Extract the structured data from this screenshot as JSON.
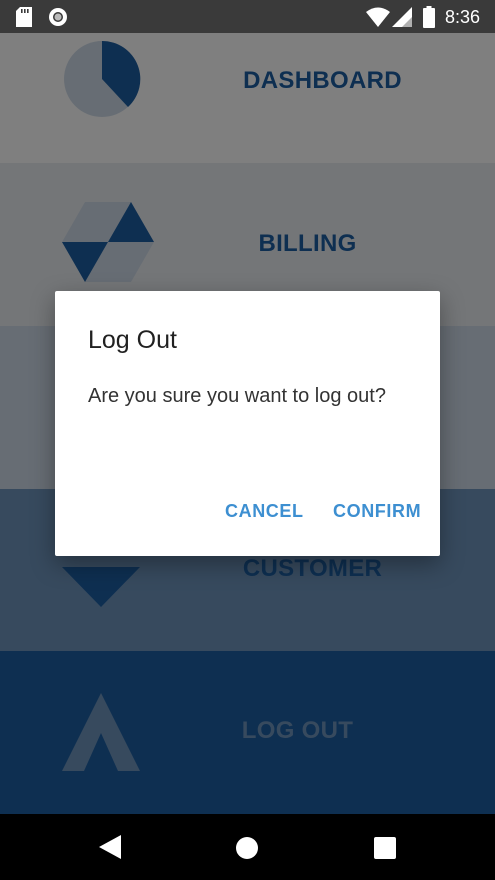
{
  "status_bar": {
    "time": "8:36",
    "icons": [
      "sd-card-icon",
      "sync-icon",
      "wifi-icon",
      "signal-icon",
      "battery-icon"
    ]
  },
  "menu": {
    "items": [
      {
        "label": "DASHBOARD",
        "icon": "pie-chart-icon"
      },
      {
        "label": "BILLING",
        "icon": "hexagon-icon"
      },
      {
        "label": "",
        "icon": "products-icon"
      },
      {
        "label": "CUSTOMER",
        "icon": "triangle-down-icon"
      },
      {
        "label": "LOG OUT",
        "icon": "arrow-up-icon"
      }
    ]
  },
  "dialog": {
    "title": "Log Out",
    "message": "Are you sure you want to log out?",
    "cancel_label": "CANCEL",
    "confirm_label": "CONFIRM"
  },
  "nav_bar": {
    "icons": [
      "back-icon",
      "home-icon",
      "recents-icon"
    ]
  },
  "colors": {
    "primary": "#1d5fa3",
    "accent": "#3d8fd1",
    "status_bar": "#3a3a3a"
  }
}
